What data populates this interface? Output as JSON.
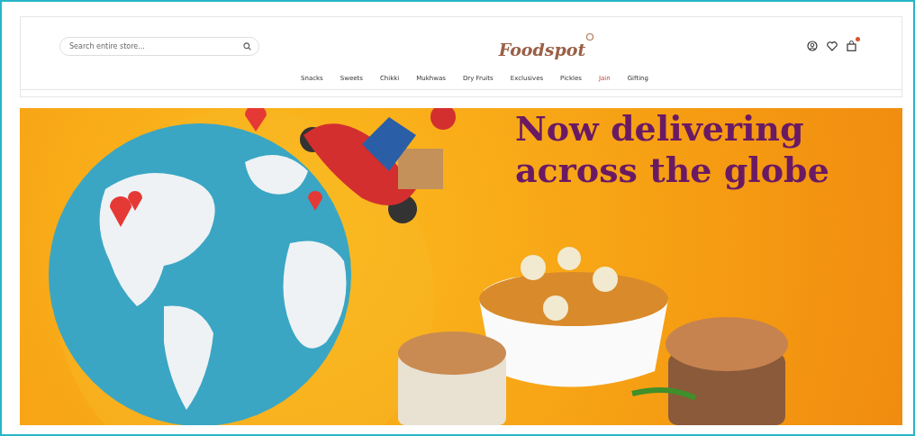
{
  "header": {
    "search": {
      "placeholder": "Search entire store..."
    },
    "logo": "Foodspot",
    "icons": [
      {
        "kind": "account"
      },
      {
        "kind": "wishlist"
      },
      {
        "kind": "cart"
      }
    ]
  },
  "nav": [
    {
      "label": "Snacks",
      "selected": false
    },
    {
      "label": "Sweets",
      "selected": false
    },
    {
      "label": "Chikki",
      "selected": false
    },
    {
      "label": "Mukhwas",
      "selected": false
    },
    {
      "label": "Dry Fruits",
      "selected": false
    },
    {
      "label": "Exclusives",
      "selected": false
    },
    {
      "label": "Pickles",
      "selected": false
    },
    {
      "label": "Jain",
      "selected": true
    },
    {
      "label": "Gifting",
      "selected": false
    }
  ],
  "banner": {
    "headline_lines": [
      "Now delivering",
      "across the globe"
    ]
  }
}
